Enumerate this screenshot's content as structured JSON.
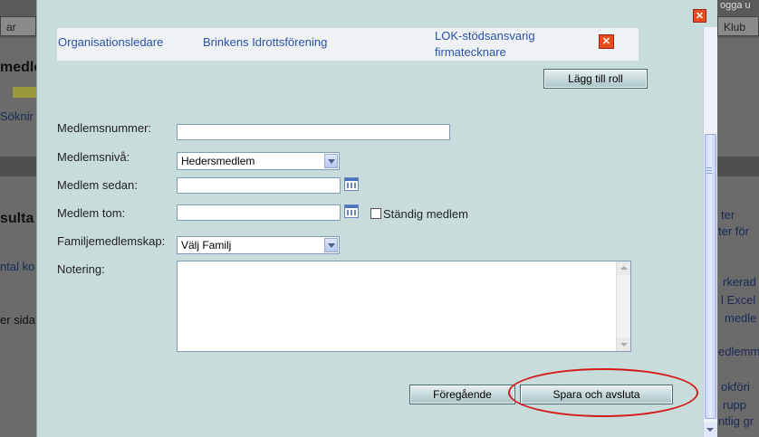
{
  "background": {
    "tabs": [
      "ar",
      "Klub"
    ],
    "top_link": "ogga u",
    "texts": [
      "medle",
      "Söknir",
      "sulta",
      "ntal ko",
      "er sida",
      "ter",
      "ter för",
      "rkerad",
      "l Excel",
      "medle",
      "edlemma",
      "okföri",
      "rupp",
      "ntlig gr"
    ]
  },
  "role_row": {
    "role": "Organisationsledare",
    "organisation": "Brinkens Idrottsförening",
    "function_line1": "LOK-stödsansvarig",
    "function_line2": "firmatecknare"
  },
  "buttons": {
    "add_role": "Lägg till roll",
    "previous": "Föregående",
    "save_close": "Spara och avsluta"
  },
  "form": {
    "member_number_label": "Medlemsnummer:",
    "member_number_value": "",
    "member_level_label": "Medlemsnivå:",
    "member_level_value": "Hedersmedlem",
    "member_since_label": "Medlem sedan:",
    "member_since_value": "",
    "member_until_label": "Medlem tom:",
    "member_until_value": "",
    "permanent_member_label": "Ständig medlem",
    "family_label": "Familjemedlemskap:",
    "family_value": "Välj Familj",
    "note_label": "Notering:",
    "note_value": ""
  },
  "colors": {
    "modal_bg": "#c8dcdc",
    "link": "#2a50a8",
    "close_red": "#e84c1c",
    "annotation": "#d41c1c"
  }
}
